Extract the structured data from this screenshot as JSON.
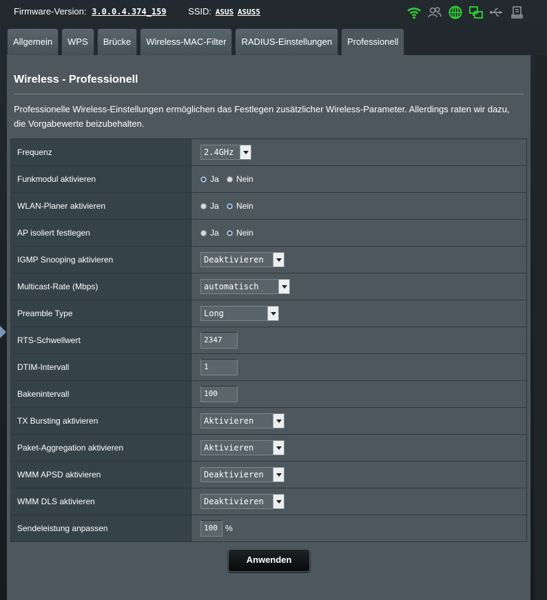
{
  "header": {
    "firmware_label": "Firmware-Version:",
    "firmware_version": "3.0.0.4.374_159",
    "ssid_label": "SSID:",
    "ssid_1": "ASUS",
    "ssid_2": "ASUS5",
    "status_icons": [
      "wifi-icon",
      "users-icon",
      "internet-globe-icon",
      "network-icon",
      "usb-icon",
      "printer-icon"
    ],
    "status_colors": {
      "active": "#2fd632",
      "inactive": "#8a9499"
    }
  },
  "tabs": [
    {
      "label": "Allgemein",
      "active": false
    },
    {
      "label": "WPS",
      "active": false
    },
    {
      "label": "Brücke",
      "active": false
    },
    {
      "label": "Wireless-MAC-Filter",
      "active": false
    },
    {
      "label": "RADIUS-Einstellungen",
      "active": false
    },
    {
      "label": "Professionell",
      "active": true
    }
  ],
  "panel": {
    "title": "Wireless - Professionell",
    "description": "Professionelle Wireless-Einstellungen ermöglichen das Festlegen zusätzlicher Wireless-Parameter. Allerdings raten wir dazu, die Vorgabewerte beizubehalten."
  },
  "settings": {
    "frequency": {
      "label": "Frequenz",
      "value": "2.4GHz"
    },
    "radio_enable": {
      "label": "Funkmodul aktivieren",
      "yes": "Ja",
      "no": "Nein",
      "selected": "yes"
    },
    "wlan_scheduler": {
      "label": "WLAN-Planer aktivieren",
      "yes": "Ja",
      "no": "Nein",
      "selected": "no"
    },
    "ap_isolated": {
      "label": "AP isoliert festlegen",
      "yes": "Ja",
      "no": "Nein",
      "selected": "no"
    },
    "igmp_snooping": {
      "label": "IGMP Snooping aktivieren",
      "value": "Deaktivieren"
    },
    "multicast_rate": {
      "label": "Multicast-Rate (Mbps)",
      "value": "automatisch"
    },
    "preamble_type": {
      "label": "Preamble Type",
      "value": "Long"
    },
    "rts_threshold": {
      "label": "RTS-Schwellwert",
      "value": "2347"
    },
    "dtim_interval": {
      "label": "DTIM-Intervall",
      "value": "1"
    },
    "beacon_interval": {
      "label": "Bakenintervall",
      "value": "100"
    },
    "tx_bursting": {
      "label": "TX Bursting aktivieren",
      "value": "Aktivieren"
    },
    "packet_aggregation": {
      "label": "Paket-Aggregation aktivieren",
      "value": "Aktivieren"
    },
    "wmm_apsd": {
      "label": "WMM APSD aktivieren",
      "value": "Deaktivieren"
    },
    "wmm_dls": {
      "label": "WMM DLS aktivieren",
      "value": "Deaktivieren"
    },
    "tx_power": {
      "label": "Sendeleistung anpassen",
      "value": "100",
      "unit": "%"
    }
  },
  "apply_button": "Anwenden"
}
